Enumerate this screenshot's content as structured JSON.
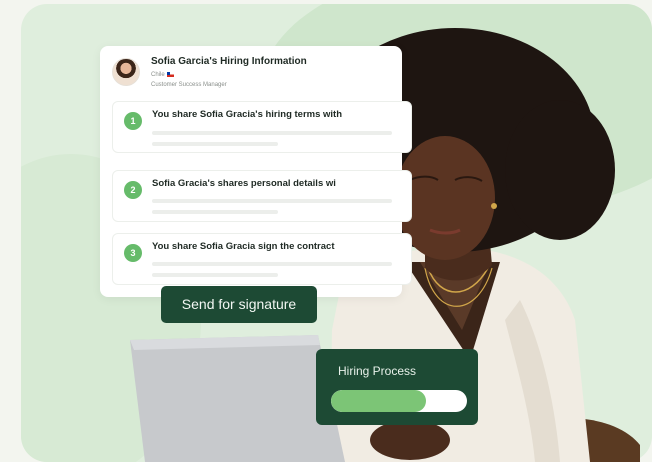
{
  "hiring_card": {
    "title": "Sofia Garcia's Hiring Information",
    "country": "Chile",
    "role": "Customer Success Manager",
    "steps": [
      {
        "number": "1",
        "text": "You share Sofia Gracia's hiring terms with"
      },
      {
        "number": "2",
        "text": "Sofia Gracia's shares personal details wi"
      },
      {
        "number": "3",
        "text": "You share Sofia Gracia sign the contract"
      }
    ]
  },
  "actions": {
    "send_for_signature": "Send for signature"
  },
  "process": {
    "title": "Hiring Process",
    "progress": 0.7
  },
  "colors": {
    "brand_dark_green": "#1d4a34",
    "accent_green": "#66bb6a",
    "progress_green": "#7cc576",
    "background_green": "#dfeedd"
  }
}
